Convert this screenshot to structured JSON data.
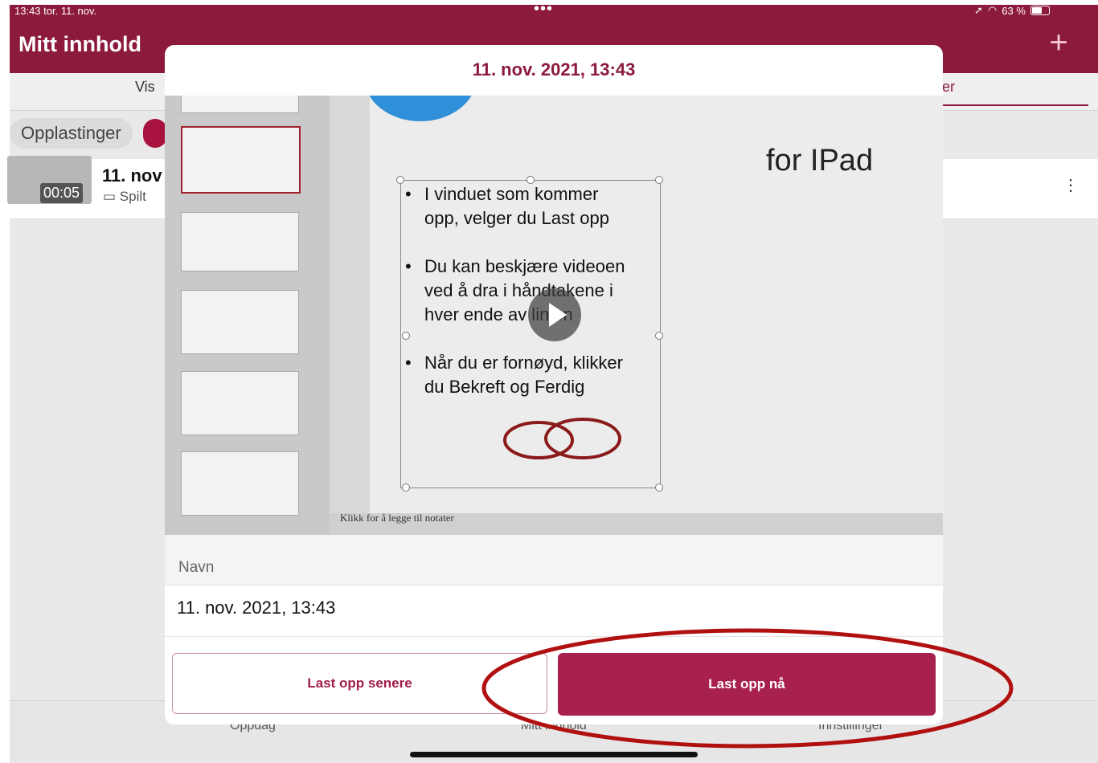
{
  "status_bar": {
    "time_date": "13:43  tor. 11. nov.",
    "dots": "•••",
    "battery": "63 %",
    "battery_level": 0.63
  },
  "header": {
    "title": "Mitt innhold",
    "add_icon": "plus-icon"
  },
  "tabs": {
    "left": "Vis",
    "right": "per"
  },
  "filter_chip": "Opplastinger",
  "list_item": {
    "duration": "00:05",
    "title": "11. nov",
    "subtitle": "Spilt"
  },
  "bottom_nav": {
    "left": "Oppdag",
    "center": "Mitt innhold",
    "right": "Innstillinger"
  },
  "modal": {
    "title": "11. nov. 2021, 13:43",
    "video": {
      "slide_heading": "for IPad",
      "bullets": [
        [
          "I vinduet som kommer",
          "opp, velger du Last opp"
        ],
        [
          "Du kan beskjære videoen",
          "ved å dra i håndtakene i",
          "hver ende av linjen"
        ],
        [
          "Når du er fornøyd, klikker",
          "du Bekreft og Ferdig"
        ]
      ],
      "notes_placeholder": "Klikk for å legge til notater"
    },
    "name_label": "Navn",
    "name_value": "11. nov. 2021, 13:43",
    "buttons": {
      "later": "Last opp senere",
      "now": "Last opp nå"
    }
  },
  "colors": {
    "brand": "#8c1a3c",
    "primary_button": "#a8204f",
    "annotation": "#b01010"
  }
}
